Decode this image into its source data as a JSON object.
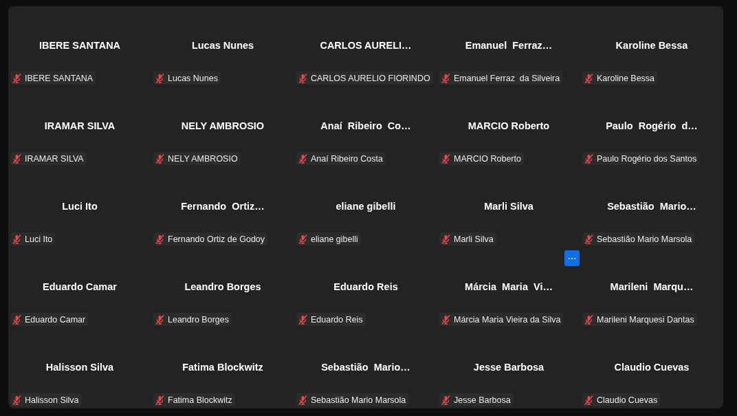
{
  "participants": [
    {
      "display_name": "IBERE SANTANA",
      "name_tag": "IBERE SANTANA",
      "muted": true,
      "hovered": false
    },
    {
      "display_name": "Lucas Nunes",
      "name_tag": "Lucas Nunes",
      "muted": true,
      "hovered": false
    },
    {
      "display_name": "CARLOS AURELI…",
      "name_tag": "CARLOS AURELIO FIORINDO",
      "muted": true,
      "hovered": false
    },
    {
      "display_name": "Emanuel  Ferraz…",
      "name_tag": "Emanuel Ferraz  da Silveira",
      "muted": true,
      "hovered": false
    },
    {
      "display_name": "Karoline Bessa",
      "name_tag": "Karoline Bessa",
      "muted": true,
      "hovered": false
    },
    {
      "display_name": "IRAMAR SILVA",
      "name_tag": "IRAMAR SILVA",
      "muted": true,
      "hovered": false
    },
    {
      "display_name": "NELY AMBROSIO",
      "name_tag": "NELY AMBROSIO",
      "muted": true,
      "hovered": false
    },
    {
      "display_name": "Anaí  Ribeiro  Co…",
      "name_tag": "Anaí Ribeiro Costa",
      "muted": true,
      "hovered": false
    },
    {
      "display_name": "MARCIO Roberto",
      "name_tag": "MARCIO Roberto",
      "muted": true,
      "hovered": false
    },
    {
      "display_name": "Paulo  Rogério  d…",
      "name_tag": "Paulo Rogério dos Santos",
      "muted": true,
      "hovered": false
    },
    {
      "display_name": "Luci Ito",
      "name_tag": "Luci Ito",
      "muted": true,
      "hovered": false
    },
    {
      "display_name": "Fernando  Ortiz…",
      "name_tag": "Fernando Ortiz de Godoy",
      "muted": true,
      "hovered": false
    },
    {
      "display_name": "eliane gibelli",
      "name_tag": "eliane gibelli",
      "muted": true,
      "hovered": false
    },
    {
      "display_name": "Marli Silva",
      "name_tag": "Marli Silva",
      "muted": true,
      "hovered": false
    },
    {
      "display_name": "Sebastião  Mario…",
      "name_tag": "Sebastião Mario Marsola",
      "muted": true,
      "hovered": false
    },
    {
      "display_name": "Eduardo Camar",
      "name_tag": "Eduardo Camar",
      "muted": true,
      "hovered": false
    },
    {
      "display_name": "Leandro Borges",
      "name_tag": "Leandro Borges",
      "muted": true,
      "hovered": false
    },
    {
      "display_name": "Eduardo Reis",
      "name_tag": "Eduardo Reis",
      "muted": true,
      "hovered": false
    },
    {
      "display_name": "Márcia  Maria  Vi…",
      "name_tag": "Márcia Maria Vieira da Silva",
      "muted": true,
      "hovered": true
    },
    {
      "display_name": "Marileni  Marqu…",
      "name_tag": "Marileni Marquesi Dantas",
      "muted": true,
      "hovered": false
    },
    {
      "display_name": "Halisson Silva",
      "name_tag": "Halisson Silva",
      "muted": true,
      "hovered": false
    },
    {
      "display_name": "Fatima Blockwitz",
      "name_tag": "Fatima Blockwitz",
      "muted": true,
      "hovered": false
    },
    {
      "display_name": "Sebastião  Mario…",
      "name_tag": "Sebastião Mario Marsola",
      "muted": true,
      "hovered": false
    },
    {
      "display_name": "Jesse Barbosa",
      "name_tag": "Jesse Barbosa",
      "muted": true,
      "hovered": false
    },
    {
      "display_name": "Claudio Cuevas",
      "name_tag": "Claudio Cuevas",
      "muted": true,
      "hovered": false
    }
  ]
}
